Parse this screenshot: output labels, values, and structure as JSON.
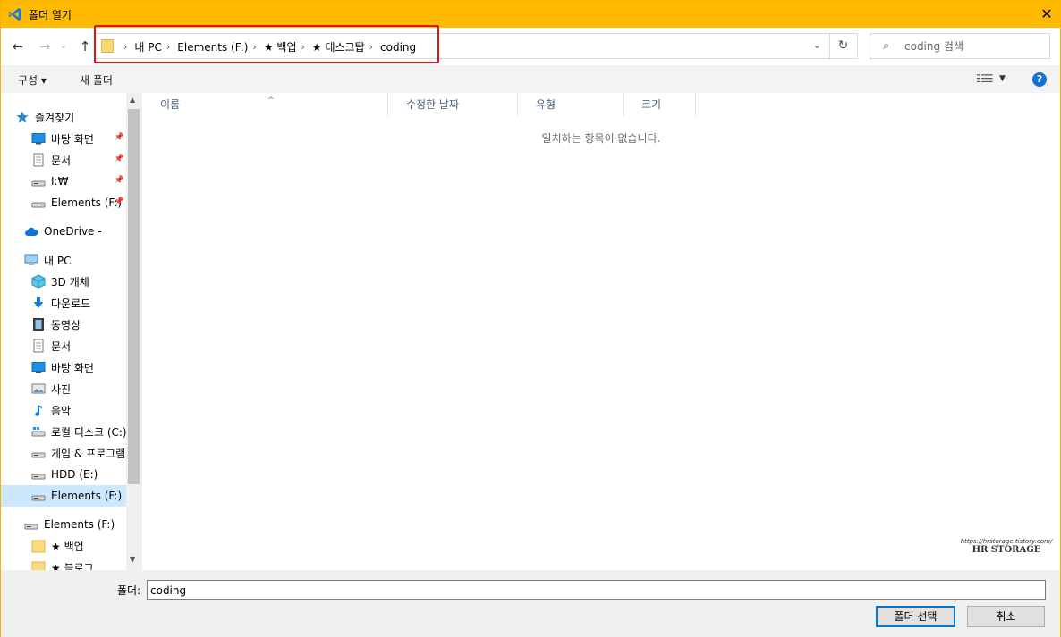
{
  "window": {
    "title": "폴더 열기",
    "close": "✕"
  },
  "nav": {
    "back": "←",
    "forward": "→",
    "recent": "⌄",
    "up": "↑",
    "breadcrumbs": [
      "내 PC",
      "Elements (F:)",
      "★ 백업",
      "★ 데스크탑",
      "coding"
    ],
    "separator": "›",
    "dropdown": "⌄",
    "refresh": "↻",
    "search_placeholder": "coding 검색"
  },
  "toolbar": {
    "organize": "구성 ▾",
    "new_folder": "새 폴더",
    "view_dd": "▼",
    "help": "?"
  },
  "sidebar": {
    "items": [
      {
        "label": "즐겨찾기",
        "icon": "star-icon",
        "pin": ""
      },
      {
        "label": "바탕 화면",
        "icon": "desktop-icon",
        "pin": "📌"
      },
      {
        "label": "문서",
        "icon": "document-icon",
        "pin": "📌"
      },
      {
        "label": "I:₩",
        "icon": "drive-icon",
        "pin": "📌"
      },
      {
        "label": "Elements (F:)",
        "icon": "drive-icon",
        "pin": "📌"
      },
      {
        "label": "OneDrive -",
        "icon": "cloud-icon",
        "pin": ""
      },
      {
        "label": "내 PC",
        "icon": "computer-icon",
        "pin": ""
      },
      {
        "label": "3D 개체",
        "icon": "cube-icon",
        "pin": ""
      },
      {
        "label": "다운로드",
        "icon": "download-icon",
        "pin": ""
      },
      {
        "label": "동영상",
        "icon": "video-icon",
        "pin": ""
      },
      {
        "label": "문서",
        "icon": "document-icon",
        "pin": ""
      },
      {
        "label": "바탕 화면",
        "icon": "desktop-icon",
        "pin": ""
      },
      {
        "label": "사진",
        "icon": "picture-icon",
        "pin": ""
      },
      {
        "label": "음악",
        "icon": "music-icon",
        "pin": ""
      },
      {
        "label": "로컬 디스크 (C:)",
        "icon": "windows-drive-icon",
        "pin": ""
      },
      {
        "label": "게임 & 프로그램",
        "icon": "drive-icon",
        "pin": ""
      },
      {
        "label": "HDD (E:)",
        "icon": "drive-icon",
        "pin": ""
      },
      {
        "label": "Elements (F:)",
        "icon": "drive-icon",
        "pin": ""
      },
      {
        "label": "Elements (F:)",
        "icon": "drive-icon",
        "pin": ""
      },
      {
        "label": "★ 백업",
        "icon": "folder-icon",
        "pin": ""
      },
      {
        "label": "★ 블로그",
        "icon": "folder-icon",
        "pin": ""
      }
    ]
  },
  "columns": [
    "이름",
    "수정한 날짜",
    "유형",
    "크기"
  ],
  "sort_arrow": "^",
  "empty_message": "일치하는 항목이 없습니다.",
  "watermark": {
    "url": "https://hrstorage.tistory.com/",
    "name": "HR STORAGE"
  },
  "bottom": {
    "folder_label": "폴더:",
    "folder_value": "coding",
    "select_button": "폴더 선택",
    "cancel_button": "취소"
  },
  "colors": {
    "titlebar": "#ffb900",
    "accent": "#0078d7",
    "highlight_box": "#e0161e",
    "selected_row": "#cce8ff"
  }
}
